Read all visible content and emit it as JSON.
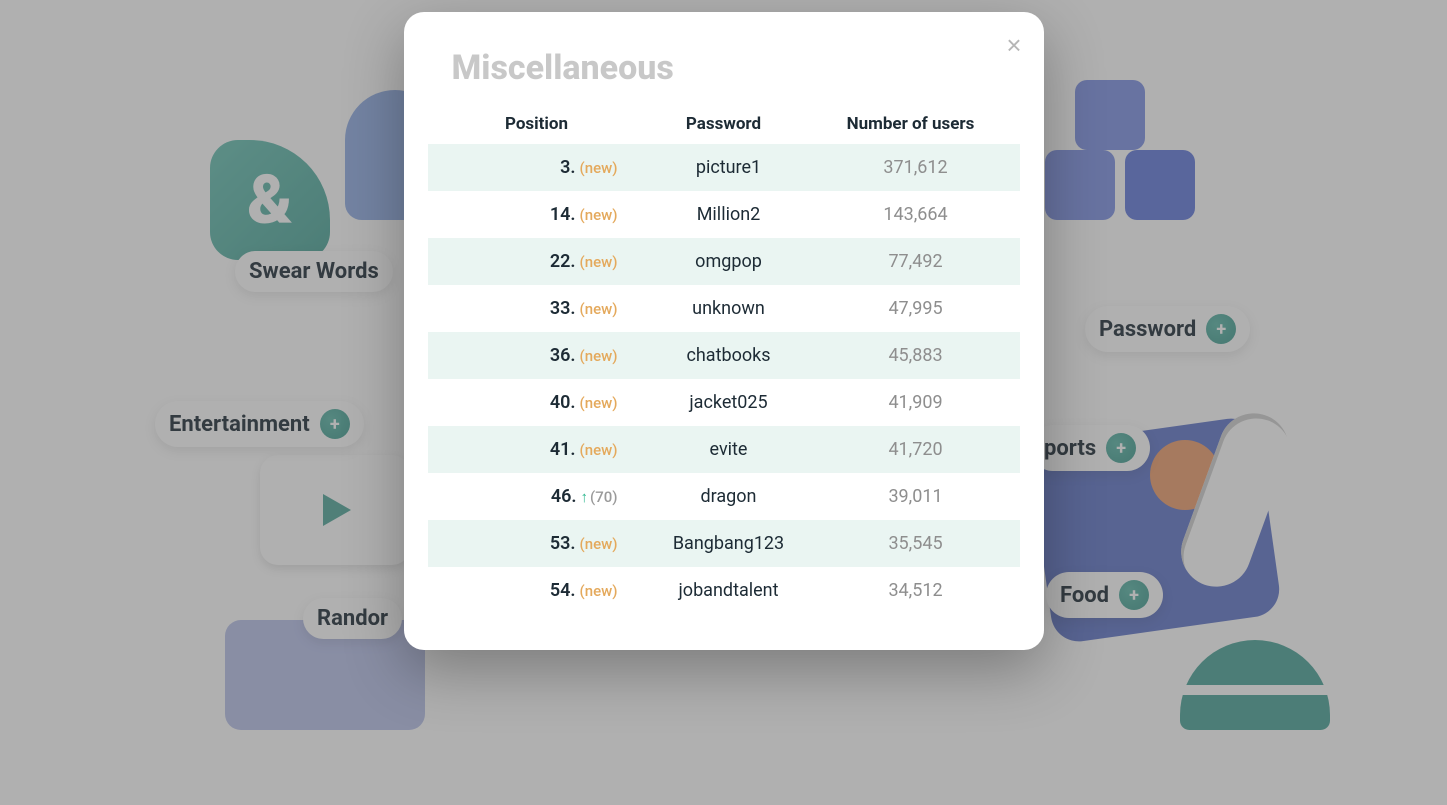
{
  "modal": {
    "title": "Miscellaneous",
    "columns": {
      "position": "Position",
      "password": "Password",
      "users": "Number of users"
    },
    "close_symbol": "×",
    "new_label": "(new)",
    "rows": [
      {
        "pos": "3.",
        "status": "new",
        "password": "picture1",
        "users": "371,612"
      },
      {
        "pos": "14.",
        "status": "new",
        "password": "Million2",
        "users": "143,664"
      },
      {
        "pos": "22.",
        "status": "new",
        "password": "omgpop",
        "users": "77,492"
      },
      {
        "pos": "33.",
        "status": "new",
        "password": "unknown",
        "users": "47,995"
      },
      {
        "pos": "36.",
        "status": "new",
        "password": "chatbooks",
        "users": "45,883"
      },
      {
        "pos": "40.",
        "status": "new",
        "password": "jacket025",
        "users": "41,909"
      },
      {
        "pos": "41.",
        "status": "new",
        "password": "evite",
        "users": "41,720"
      },
      {
        "pos": "46.",
        "status": "rise",
        "rise_value": "(70)",
        "password": "dragon",
        "users": "39,011"
      },
      {
        "pos": "53.",
        "status": "new",
        "password": "Bangbang123",
        "users": "35,545"
      },
      {
        "pos": "54.",
        "status": "new",
        "password": "jobandtalent",
        "users": "34,512"
      }
    ]
  },
  "background": {
    "pills": {
      "swear_words": "Swear Words",
      "entertainment": "Entertainment",
      "random": "Randor",
      "password": "Password",
      "sports": "ports",
      "food": "Food"
    },
    "ampersand": "&",
    "plus": "+"
  }
}
